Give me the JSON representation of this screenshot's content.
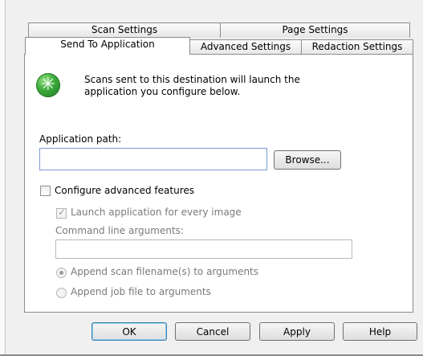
{
  "tabs": {
    "row1": [
      "Scan Settings",
      "Page Settings"
    ],
    "row2": [
      "Send To Application",
      "Advanced Settings",
      "Redaction Settings"
    ]
  },
  "info": {
    "icon": "green-star-icon",
    "line1": "Scans sent to this destination will launch the",
    "line2": "application you configure below."
  },
  "app_path": {
    "label": "Application path:",
    "value": ""
  },
  "browse_label": "Browse...",
  "configure_label": "Configure advanced features",
  "launch_label": "Launch application for every image",
  "launch_checked": true,
  "cmd": {
    "label": "Command line arguments:",
    "value": ""
  },
  "radio": {
    "append_scan": "Append scan filename(s) to arguments",
    "append_job": "Append job file to arguments"
  },
  "buttons": {
    "ok": "OK",
    "cancel": "Cancel",
    "apply": "Apply",
    "help": "Help"
  }
}
